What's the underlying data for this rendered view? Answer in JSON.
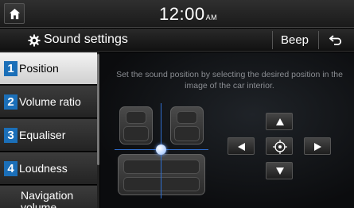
{
  "status_bar": {
    "time": "12:00",
    "ampm": "AM"
  },
  "title_bar": {
    "title": "Sound settings",
    "beep_label": "Beep"
  },
  "sidebar": {
    "items": [
      {
        "number": "1",
        "label": "Position",
        "active": true
      },
      {
        "number": "2",
        "label": "Volume ratio",
        "active": false
      },
      {
        "number": "3",
        "label": "Equaliser",
        "active": false
      },
      {
        "number": "4",
        "label": "Loudness",
        "active": false
      },
      {
        "number": "",
        "label_line1": "Navigation",
        "label_line2": "volume",
        "active": false
      }
    ]
  },
  "main": {
    "instruction": "Set the sound position by selecting the desired position in the image of the car interior."
  },
  "colors": {
    "accent": "#1b6fb8",
    "guide_line": "#2f6fd1"
  }
}
